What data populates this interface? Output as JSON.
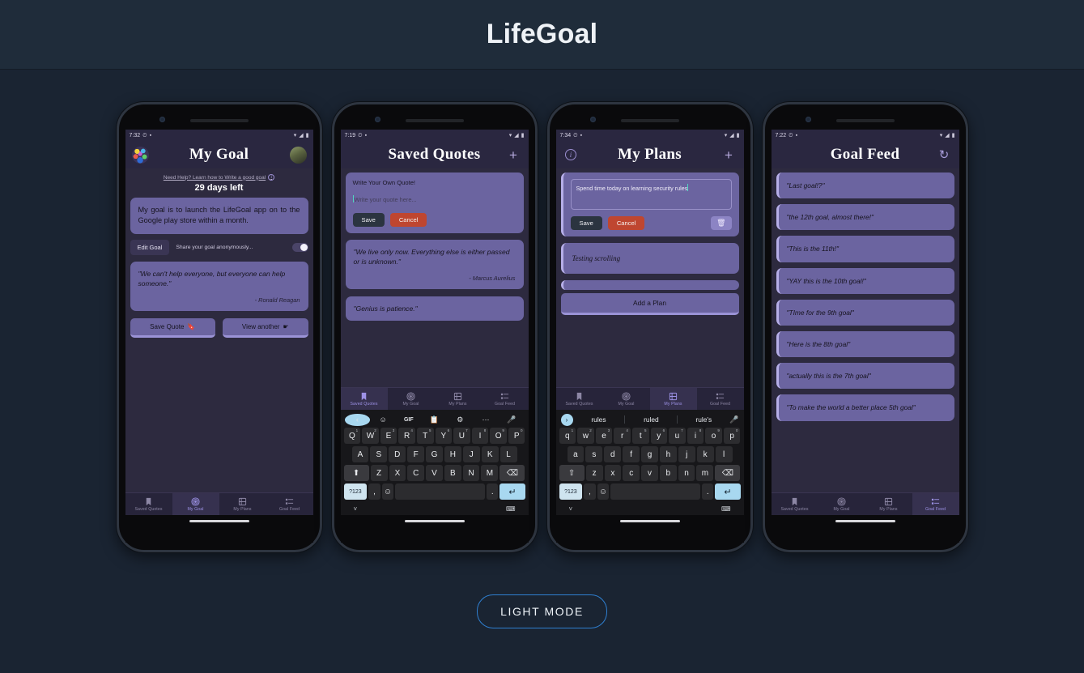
{
  "page": {
    "title": "LifeGoal",
    "light_mode_button": "LIGHT MODE",
    "background_color": "#1a2432",
    "header_color": "#1f2c3a",
    "accent_card_color": "#6b64a0",
    "nav_active_color": "#9d92e6"
  },
  "nav": {
    "items": [
      {
        "label": "Saved Quotes",
        "icon": "bookmark-icon"
      },
      {
        "label": "My Goal",
        "icon": "target-icon"
      },
      {
        "label": "My Plans",
        "icon": "plans-icon"
      },
      {
        "label": "Goal Feed",
        "icon": "feed-list-icon"
      }
    ]
  },
  "phones": [
    {
      "id": "my-goal",
      "status": {
        "time": "7:32",
        "icons": "alarm, vibrate, wifi, signal, battery"
      },
      "appbar": {
        "title": "My Goal",
        "left_icon": "app-logo-tree-icon",
        "right_icon": "user-avatar"
      },
      "help_link": "Need Help? Learn how to Write a good goal",
      "days_left": "29 days left",
      "goal_text": "My goal is to launch the LifeGoal app on to the Google play store within a month.",
      "edit_goal_button": "Edit Goal",
      "share_label": "Share your goal anonymously...",
      "share_toggle_state": "on",
      "quote": "\"We can't help everyone, but everyone can help someone.\"",
      "quote_author": "- Ronald Reagan",
      "save_quote_button": "Save Quote",
      "view_another_button": "View another",
      "active_nav": 1
    },
    {
      "id": "saved-quotes",
      "status": {
        "time": "7:19"
      },
      "appbar": {
        "title": "Saved Quotes",
        "right_icon": "plus-icon"
      },
      "compose_title": "Write Your Own Quote!",
      "compose_placeholder": "Write your quote here...",
      "save_button": "Save",
      "cancel_button": "Cancel",
      "quotes": [
        {
          "text": "\"We live only now. Everything else is either passed or is unknown.\"",
          "author": "- Marcus Aurelius"
        },
        {
          "text": "\"Genius is patience.\"",
          "author": ""
        }
      ],
      "active_nav": 0,
      "keyboard": {
        "tools": [
          "chevron-left-icon",
          "sticker-icon",
          "GIF",
          "clipboard-icon",
          "gear-icon",
          "divider",
          "more-icon",
          "mic-icon"
        ],
        "row1": [
          {
            "k": "Q",
            "n": "1"
          },
          {
            "k": "W",
            "n": "2"
          },
          {
            "k": "E",
            "n": "3"
          },
          {
            "k": "R",
            "n": "4"
          },
          {
            "k": "T",
            "n": "5"
          },
          {
            "k": "Y",
            "n": "6"
          },
          {
            "k": "U",
            "n": "7"
          },
          {
            "k": "I",
            "n": "8"
          },
          {
            "k": "O",
            "n": "9"
          },
          {
            "k": "P",
            "n": "0"
          }
        ],
        "row2": [
          "A",
          "S",
          "D",
          "F",
          "G",
          "H",
          "J",
          "K",
          "L"
        ],
        "row3": [
          "Z",
          "X",
          "C",
          "V",
          "B",
          "N",
          "M"
        ],
        "fn_key": "?123",
        "comma_key": ",",
        "emoji_key": "emoji-icon",
        "period_key": ".",
        "enter_key": "enter-icon",
        "shift_key": "shift-icon",
        "backspace_key": "backspace-icon"
      }
    },
    {
      "id": "my-plans",
      "status": {
        "time": "7:34"
      },
      "appbar": {
        "title": "My Plans",
        "left_icon": "info-icon",
        "right_icon": "plus-icon"
      },
      "plan_input_value": "Spend time today on learning security rules",
      "plan_input_underlined": "rules",
      "save_button": "Save",
      "cancel_button": "Cancel",
      "delete_button": "trash-icon",
      "plans": [
        "Testing scrolling"
      ],
      "add_plan_button": "Add a Plan",
      "active_nav": 2,
      "keyboard": {
        "suggestions": [
          "rules",
          "ruled",
          "rule's"
        ],
        "row1": [
          {
            "k": "q",
            "n": "1"
          },
          {
            "k": "w",
            "n": "2"
          },
          {
            "k": "e",
            "n": "3"
          },
          {
            "k": "r",
            "n": "4"
          },
          {
            "k": "t",
            "n": "5"
          },
          {
            "k": "y",
            "n": "6"
          },
          {
            "k": "u",
            "n": "7"
          },
          {
            "k": "i",
            "n": "8"
          },
          {
            "k": "o",
            "n": "9"
          },
          {
            "k": "p",
            "n": "0"
          }
        ],
        "row2": [
          "a",
          "s",
          "d",
          "f",
          "g",
          "h",
          "j",
          "k",
          "l"
        ],
        "row3": [
          "z",
          "x",
          "c",
          "v",
          "b",
          "n",
          "m"
        ],
        "fn_key": "?123",
        "comma_key": ",",
        "emoji_key": "emoji-icon",
        "period_key": ".",
        "enter_key": "enter-icon",
        "shift_key": "shift-icon",
        "backspace_key": "backspace-icon"
      }
    },
    {
      "id": "goal-feed",
      "status": {
        "time": "7:22"
      },
      "appbar": {
        "title": "Goal Feed",
        "right_icon": "refresh-icon"
      },
      "feed": [
        "\"Last goal!?\"",
        "\"the 12th goal, almost there!\"",
        "\"This is the 11th!\"",
        "\"YAY this is the 10th goal!\"",
        "\"TIme for the 9th goal\"",
        "\"Here is the 8th goal\"",
        "\"actually this is the 7th goal\"",
        "\"To make the world a better place 5th goal\""
      ],
      "active_nav": 3
    }
  ]
}
